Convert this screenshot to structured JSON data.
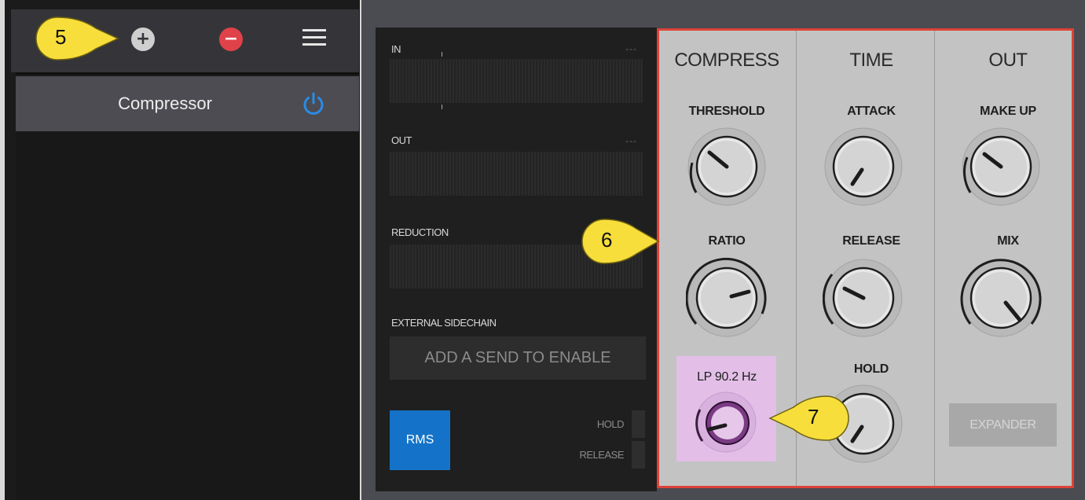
{
  "toolbar": {
    "add_icon": "plus-circle-icon",
    "remove_icon": "minus-circle-icon",
    "menu_icon": "hamburger-menu-icon"
  },
  "device": {
    "name": "Compressor",
    "power_icon": "power-icon",
    "power_color": "#2a8be8"
  },
  "meters": {
    "in_label": "IN",
    "in_value": "---",
    "out_label": "OUT",
    "out_value": "---",
    "reduction_label": "REDUCTION"
  },
  "sidechain": {
    "label": "EXTERNAL SIDECHAIN",
    "button": "ADD A SEND TO ENABLE"
  },
  "detector": {
    "rms_button": "RMS",
    "rms_color": "#1473c8",
    "hold_label": "HOLD",
    "release_label": "RELEASE"
  },
  "sections": {
    "compress": {
      "title": "COMPRESS",
      "threshold_label": "THRESHOLD",
      "ratio_label": "RATIO",
      "filter_label": "LP 90.2 Hz"
    },
    "time": {
      "title": "TIME",
      "attack_label": "ATTACK",
      "release_label": "RELEASE",
      "hold_label": "HOLD"
    },
    "out": {
      "title": "OUT",
      "makeup_label": "MAKE UP",
      "mix_label": "MIX",
      "expander_button": "EXPANDER"
    }
  },
  "callouts": {
    "toolbar": "5",
    "knob_section": "6",
    "filter_knob": "7"
  },
  "colors": {
    "highlight_border": "#dd4238",
    "filter_highlight": "#e3bfe8",
    "callout_fill": "#f7de3b",
    "remove_icon": "#e0424a"
  }
}
